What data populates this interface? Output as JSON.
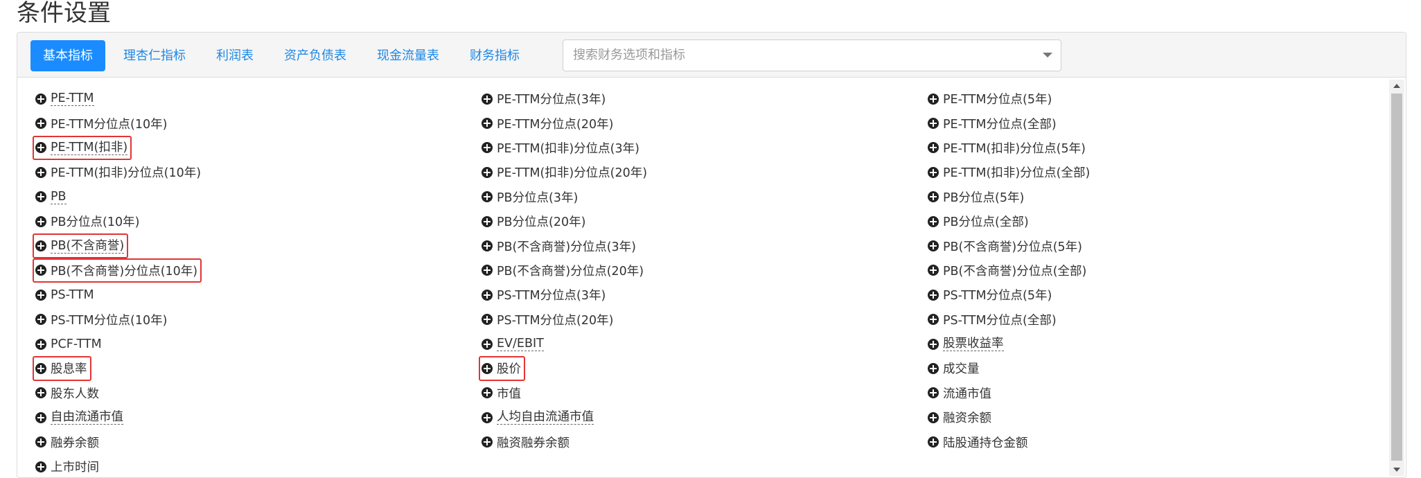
{
  "page": {
    "title": "条件设置"
  },
  "tabs": [
    {
      "label": "基本指标",
      "active": true
    },
    {
      "label": "理杏仁指标",
      "active": false
    },
    {
      "label": "利润表",
      "active": false
    },
    {
      "label": "资产负债表",
      "active": false
    },
    {
      "label": "现金流量表",
      "active": false
    },
    {
      "label": "财务指标",
      "active": false
    }
  ],
  "search": {
    "placeholder": "搜索财务选项和指标"
  },
  "colors": {
    "accent": "#1a8cff",
    "link": "#1e88e5",
    "highlight": "#e23434"
  },
  "columns": [
    [
      {
        "label": "PE-TTM",
        "tip": true
      },
      {
        "label": "PE-TTM分位点(10年)"
      },
      {
        "label": "PE-TTM(扣非)",
        "tip": true,
        "highlight": true
      },
      {
        "label": "PE-TTM(扣非)分位点(10年)"
      },
      {
        "label": "PB",
        "tip": true
      },
      {
        "label": "PB分位点(10年)"
      },
      {
        "label": "PB(不含商誉)",
        "tip": true,
        "highlight": true
      },
      {
        "label": "PB(不含商誉)分位点(10年)",
        "highlight": true
      },
      {
        "label": "PS-TTM"
      },
      {
        "label": "PS-TTM分位点(10年)"
      },
      {
        "label": "PCF-TTM"
      },
      {
        "label": "股息率",
        "highlight": true
      },
      {
        "label": "股东人数"
      },
      {
        "label": "自由流通市值",
        "tip": true
      },
      {
        "label": "融券余额"
      },
      {
        "label": "上市时间"
      }
    ],
    [
      {
        "label": "PE-TTM分位点(3年)"
      },
      {
        "label": "PE-TTM分位点(20年)"
      },
      {
        "label": "PE-TTM(扣非)分位点(3年)"
      },
      {
        "label": "PE-TTM(扣非)分位点(20年)"
      },
      {
        "label": "PB分位点(3年)"
      },
      {
        "label": "PB分位点(20年)"
      },
      {
        "label": "PB(不含商誉)分位点(3年)"
      },
      {
        "label": "PB(不含商誉)分位点(20年)"
      },
      {
        "label": "PS-TTM分位点(3年)"
      },
      {
        "label": "PS-TTM分位点(20年)"
      },
      {
        "label": "EV/EBIT",
        "tip": true
      },
      {
        "label": "股价",
        "highlight": true
      },
      {
        "label": "市值"
      },
      {
        "label": "人均自由流通市值",
        "tip": true
      },
      {
        "label": "融资融券余额"
      }
    ],
    [
      {
        "label": "PE-TTM分位点(5年)"
      },
      {
        "label": "PE-TTM分位点(全部)"
      },
      {
        "label": "PE-TTM(扣非)分位点(5年)"
      },
      {
        "label": "PE-TTM(扣非)分位点(全部)"
      },
      {
        "label": "PB分位点(5年)"
      },
      {
        "label": "PB分位点(全部)"
      },
      {
        "label": "PB(不含商誉)分位点(5年)"
      },
      {
        "label": "PB(不含商誉)分位点(全部)"
      },
      {
        "label": "PS-TTM分位点(5年)"
      },
      {
        "label": "PS-TTM分位点(全部)"
      },
      {
        "label": "股票收益率",
        "tip": true
      },
      {
        "label": "成交量"
      },
      {
        "label": "流通市值"
      },
      {
        "label": "融资余额"
      },
      {
        "label": "陆股通持仓金额"
      }
    ]
  ]
}
